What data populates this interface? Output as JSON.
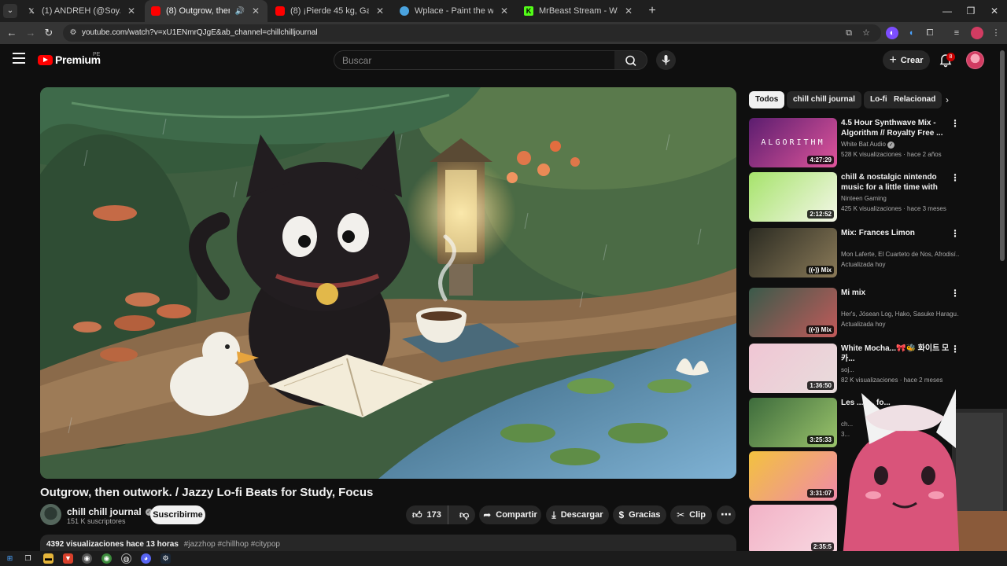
{
  "browser": {
    "tabs": [
      {
        "title": "(1) ANDREH (@SoyAndreh) / X",
        "icon": "x-logo-icon",
        "active": false
      },
      {
        "title": "(8) Outgrow, then outwork",
        "icon": "youtube-icon",
        "active": true,
        "audio": true
      },
      {
        "title": "(8) ¡Pierde 45 kg, Gana 250,000",
        "icon": "youtube-icon",
        "active": false
      },
      {
        "title": "Wplace - Paint the world",
        "icon": "wplace-icon",
        "active": false
      },
      {
        "title": "MrBeast Stream - Watch Live or",
        "icon": "kick-icon",
        "active": false
      }
    ],
    "url": "youtube.com/watch?v=xU1ENmrQJgE&ab_channel=chillchilljournal"
  },
  "masthead": {
    "logo_text": "Premium",
    "country_code": "PE",
    "search_placeholder": "Buscar",
    "create_label": "Crear",
    "notification_count": "8"
  },
  "video": {
    "title": "Outgrow, then outwork. / Jazzy Lo-fi Beats for Study, Focus",
    "channel": "chill chill journal",
    "subscribers": "151 K suscriptores",
    "subscribe_label": "Suscribirme",
    "likes": "173",
    "share_label": "Compartir",
    "download_label": "Descargar",
    "thanks_label": "Gracias",
    "clip_label": "Clip",
    "views": "4392 visualizaciones",
    "uploaded": "hace 13 horas",
    "hashtags": "#jazzhop #chillhop #citypop"
  },
  "chips": [
    "Todos",
    "chill chill journal",
    "Lo-fi",
    "Relacionad"
  ],
  "recommendations": [
    {
      "title": "4.5 Hour Synthwave Mix - Algorithm // Royalty Free ...",
      "channel": "White Bat Audio",
      "verified": true,
      "meta": "528 K visualizaciones · hace 2 años",
      "badge": "4:27:29",
      "thumb_text": "ALGORITHM",
      "colors": [
        "#5b1d6f",
        "#e0559b"
      ]
    },
    {
      "title": "chill & nostalgic nintendo music for a little time with yourself.",
      "channel": "Ninteen Gaming",
      "verified": false,
      "meta": "425 K visualizaciones · hace 3 meses",
      "badge": "2:12:52",
      "colors": [
        "#a6e36b",
        "#f4f7e8"
      ]
    },
    {
      "title": "Mix: Frances Limon",
      "channel": "Mon Laferte, El Cuarteto de Nos, Afrodisí...",
      "verified": false,
      "meta": "Actualizada hoy",
      "badge": "Mix",
      "colors": [
        "#2b2b22",
        "#8a7a58"
      ]
    },
    {
      "title": "Mi mix",
      "channel": "Her's, Jósean Log, Hako, Sasuke Haragu...",
      "verified": false,
      "meta": "Actualizada hoy",
      "badge": "Mix",
      "colors": [
        "#3a5a4a",
        "#c25a5a"
      ]
    },
    {
      "title": "White Mocha...🎀🐝 화이트 모카...",
      "channel": "soj...",
      "verified": false,
      "meta": "82 K visualizaciones · hace 2 meses",
      "badge": "1:36:50",
      "colors": [
        "#f0c6d4",
        "#e8dcdc"
      ]
    },
    {
      "title": "Les ...k... fo...",
      "channel": "ch...",
      "verified": false,
      "meta": "3...",
      "badge": "3:25:33",
      "colors": [
        "#3d6b3c",
        "#9ac36b"
      ]
    },
    {
      "title": "",
      "channel": "",
      "verified": false,
      "meta": "",
      "badge": "3:31:07",
      "colors": [
        "#f2c23f",
        "#f08aa8"
      ]
    },
    {
      "title": "",
      "channel": "",
      "verified": false,
      "meta": "",
      "badge": "2:35:5",
      "colors": [
        "#f2b2c6",
        "#f8d9e2"
      ]
    }
  ]
}
